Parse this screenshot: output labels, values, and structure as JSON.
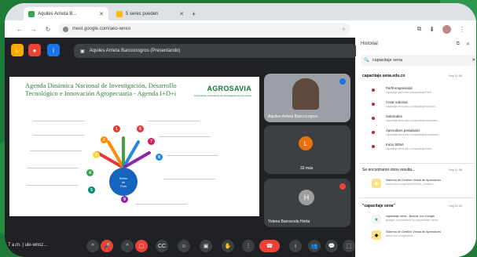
{
  "colors": {
    "accent": "#1a73e8",
    "end_call": "#ea4335",
    "brand_green": "#0e7a36",
    "desktop": "#1f7a3a"
  },
  "browser": {
    "tabs": [
      {
        "label": "Aquiles Arrieta B...",
        "icon": "meet-favicon-icon"
      },
      {
        "label": "5 seres pueden",
        "icon": "page-favicon-icon"
      }
    ],
    "url": "meet.google.com/aeo-wneo"
  },
  "meet": {
    "presenting_label": "Aquiles Arrieta Barcocrogros (Presentando)",
    "slide": {
      "title": "Agenda Dinámica Nacional de Investigación, Desarrollo Tecnológico e Innovación Agropecuaria - Agenda I+D+i",
      "logo": "AGROSAVIA",
      "logo_sub": "Corporación colombiana de investigación agropecuaria",
      "hub_lines": [
        "Retos",
        "de",
        "País"
      ],
      "numbers": [
        "1",
        "2",
        "3",
        "4",
        "5",
        "6",
        "7",
        "8",
        "9"
      ]
    },
    "participants": [
      {
        "name": "Aquiles Arrieta Barcocrogros",
        "initial": ""
      },
      {
        "name": "33 más",
        "initial": "L"
      },
      {
        "name": "Yolena Barracoda Horta",
        "initial": "H"
      }
    ],
    "clock": "7 a.m.  |  ule-wnsz..."
  },
  "sidebar": {
    "title": "Historial",
    "search_value": "capacitaje sena",
    "groups": [
      {
        "header": "capacitaje.sena.edu.co",
        "time": "Hoy 11:40",
        "items": [
          {
            "title": "Perfil empresarial",
            "url": "capacitaje.sena.edu.co/capacitaje/Perfil..."
          },
          {
            "title": "Crear solicitud",
            "url": "capacitaje.sena.edu.co/capacitaje/solicitud..."
          },
          {
            "title": "Solicitudes",
            "url": "capacitaje.sena.edu.co/capacitaje/solicitudes..."
          },
          {
            "title": "Aprendices postulados",
            "url": "capacitaje.sena.edu.co/capacitaje/postulados..."
          },
          {
            "title": "Inicio SENA",
            "url": "capacitaje.sena.edu.co/capacitaje/index..."
          }
        ]
      },
      {
        "header": "Se encontraron otros resulta...",
        "time": "Hoy 11:36",
        "items": [
          {
            "title": "Sistema de Gestión Virtual de Aprendices",
            "url": "sena.edu.co/gestion/SENA_Gestion..."
          }
        ]
      },
      {
        "header": "\"capacitaje sena\"",
        "time": "Hoy 11:33",
        "items": [
          {
            "title": "capacitaje sena - Buscar con Google",
            "url": "google.com/search?q=capacitaje+sena"
          },
          {
            "title": "Sistema de Gestión Virtual de Aprendices",
            "url": "sena.edu.co/gestion..."
          }
        ]
      }
    ]
  }
}
